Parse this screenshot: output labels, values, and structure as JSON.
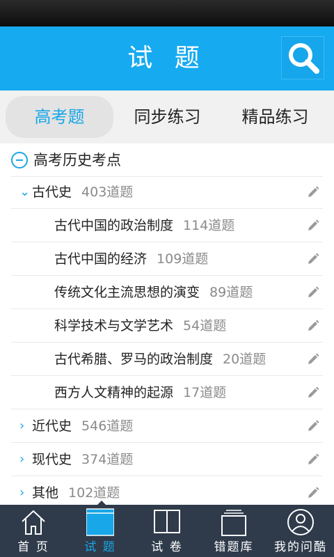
{
  "header": {
    "title": "试 题"
  },
  "tabs": [
    {
      "label": "高考题",
      "active": true
    },
    {
      "label": "同步练习",
      "active": false
    },
    {
      "label": "精品练习",
      "active": false
    }
  ],
  "tree": {
    "root": {
      "label": "高考历史考点"
    },
    "sections": [
      {
        "label": "古代史",
        "count": "403道题",
        "expanded": true,
        "children": [
          {
            "label": "古代中国的政治制度",
            "count": "114道题"
          },
          {
            "label": "古代中国的经济",
            "count": "109道题"
          },
          {
            "label": "传统文化主流思想的演变",
            "count": "89道题"
          },
          {
            "label": "科学技术与文学艺术",
            "count": "54道题"
          },
          {
            "label": "古代希腊、罗马的政治制度",
            "count": "20道题"
          },
          {
            "label": "西方人文精神的起源",
            "count": "17道题"
          }
        ]
      },
      {
        "label": "近代史",
        "count": "546道题",
        "expanded": false
      },
      {
        "label": "现代史",
        "count": "374道题",
        "expanded": false
      },
      {
        "label": "其他",
        "count": "102道题",
        "expanded": false
      }
    ]
  },
  "bottom_nav": [
    {
      "label": "首 页",
      "icon": "home-icon",
      "active": false
    },
    {
      "label": "试 题",
      "icon": "question-book-icon",
      "active": true
    },
    {
      "label": "试 卷",
      "icon": "open-book-icon",
      "active": false
    },
    {
      "label": "错题库",
      "icon": "folder-stack-icon",
      "active": false
    },
    {
      "label": "我的问酷",
      "icon": "user-profile-icon",
      "active": false
    }
  ],
  "colors": {
    "accent": "#16aaf0",
    "nav_bg": "#2f3b4b",
    "count_text": "#8a8a8a"
  }
}
